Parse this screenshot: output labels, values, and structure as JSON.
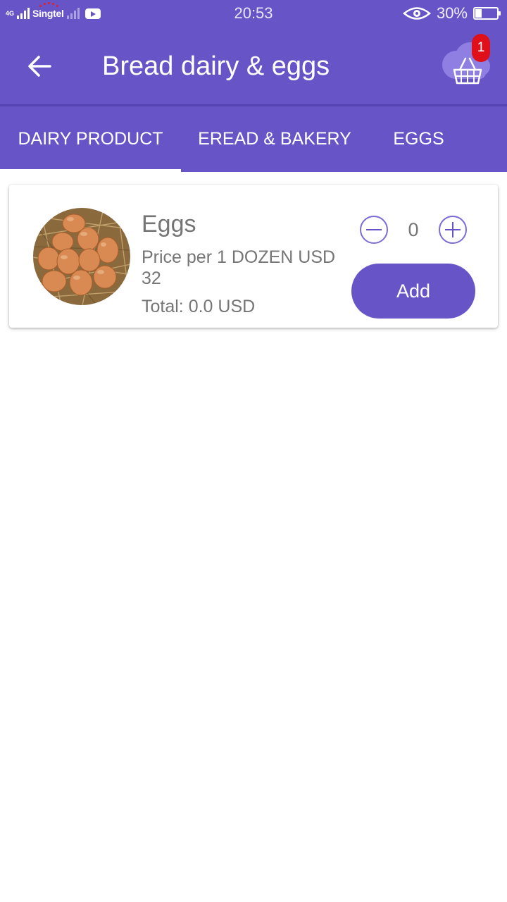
{
  "status_bar": {
    "network_type": "4G",
    "carrier": "Singtel",
    "time": "20:53",
    "battery_percent": "30%",
    "battery_level": 0.3,
    "icons": [
      "signal-icon",
      "youtube-icon",
      "eye-icon",
      "battery-icon"
    ]
  },
  "toolbar": {
    "title": "Bread dairy & eggs",
    "back_icon": "arrow-left-icon",
    "cart_icon": "basket-icon",
    "cart_badge": "1"
  },
  "tabs": [
    {
      "label": "DAIRY PRODUCT",
      "selected": true
    },
    {
      "label": "EREAD & BAKERY",
      "selected": false
    },
    {
      "label": "EGGS",
      "selected": false
    }
  ],
  "product": {
    "name": "Eggs",
    "price": "Price per 1 DOZEN USD 32",
    "total": "Total: 0.0 USD",
    "quantity": "0",
    "add_label": "Add",
    "image": "eggs-in-nest-image"
  },
  "colors": {
    "primary": "#6755c8",
    "badge": "#e0101a",
    "text_gray": "#757575",
    "background": "#ffffff"
  }
}
